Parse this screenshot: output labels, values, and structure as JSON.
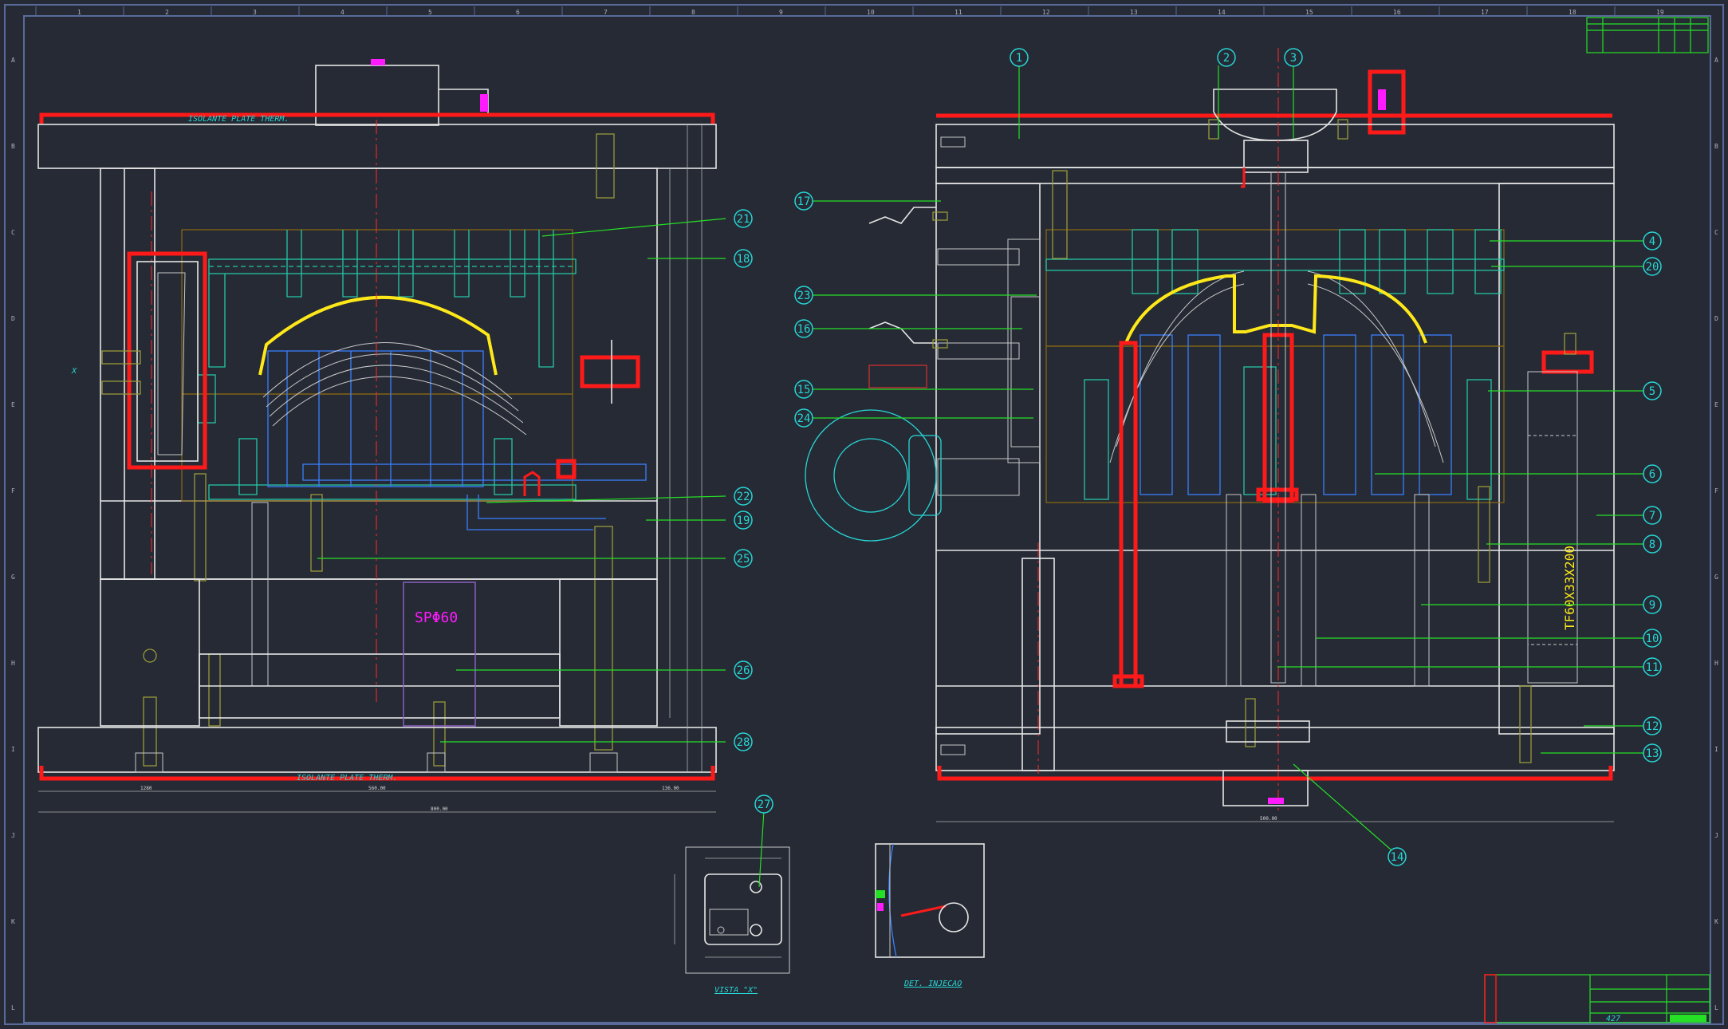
{
  "zone_numbers": [
    "1",
    "2",
    "3",
    "4",
    "5",
    "6",
    "7",
    "8",
    "9",
    "10",
    "11",
    "12",
    "13",
    "14",
    "15",
    "16",
    "17",
    "18",
    "19"
  ],
  "zone_letters": [
    "A",
    "B",
    "C",
    "D",
    "E",
    "F",
    "G",
    "H",
    "I",
    "J",
    "K",
    "L"
  ],
  "balloons": [
    "1",
    "2",
    "3",
    "4",
    "5",
    "6",
    "7",
    "8",
    "9",
    "10",
    "11",
    "12",
    "13",
    "14",
    "15",
    "16",
    "17",
    "18",
    "19",
    "20",
    "21",
    "22",
    "23",
    "24",
    "25",
    "26",
    "27",
    "28"
  ],
  "labels": {
    "isolante_top": "ISOLANTE PLATE THERM.",
    "isolante_bottom": "ISOLANTE PLATE THERM.",
    "vista_x": "VISTA \"X\"",
    "det_injecao": "DET. INJECAO",
    "sp60": "SPΦ60",
    "tf_label": "TF60X33X200",
    "x_marker": "X",
    "bottom_dim_left": "1280",
    "bottom_dim_center": "560.00",
    "bottom_dim_right": "136.00",
    "bottom_dim_total": "800.00",
    "right_bottom_dim": "500.00",
    "part_number": "427"
  },
  "colors": {
    "background": "#252a34",
    "plate": "#e6e6e6",
    "red": "#ff1a1a",
    "cyan": "#27d6d6",
    "green": "#26e026",
    "yellow": "#ffe81a",
    "blue": "#3b7fff",
    "magenta": "#ff1aff"
  }
}
